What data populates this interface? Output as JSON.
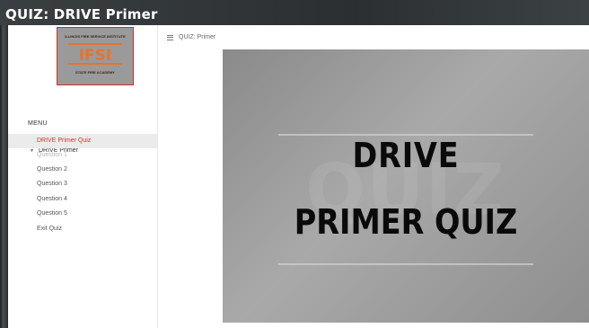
{
  "window": {
    "title": "QUIZ: DRIVE Primer"
  },
  "sidebar": {
    "logo": {
      "top_text": "ILLINOIS FIRE SERVICE INSTITUTE",
      "mark_text": "IFSI",
      "bottom_text": "STATE FIRE ACADEMY"
    },
    "menu_label": "MENU",
    "tree_root": "DRIVE Primer",
    "items": [
      {
        "label": "DRIVE Primer Quiz",
        "state": "active"
      },
      {
        "label": "Question 1",
        "state": "disabled"
      },
      {
        "label": "Question 2",
        "state": "normal"
      },
      {
        "label": "Question 3",
        "state": "normal"
      },
      {
        "label": "Question 4",
        "state": "normal"
      },
      {
        "label": "Question 5",
        "state": "normal"
      },
      {
        "label": "Exit Quiz",
        "state": "normal"
      }
    ]
  },
  "main": {
    "breadcrumb": "QUIZ: Primer",
    "slide": {
      "watermark": "QUIZ",
      "line1": "DRIVE",
      "line2": "PRIMER QUIZ"
    }
  },
  "colors": {
    "accent": "#d9302a",
    "active_bg": "#ebebeb",
    "disabled_text": "#b5b5b5"
  }
}
